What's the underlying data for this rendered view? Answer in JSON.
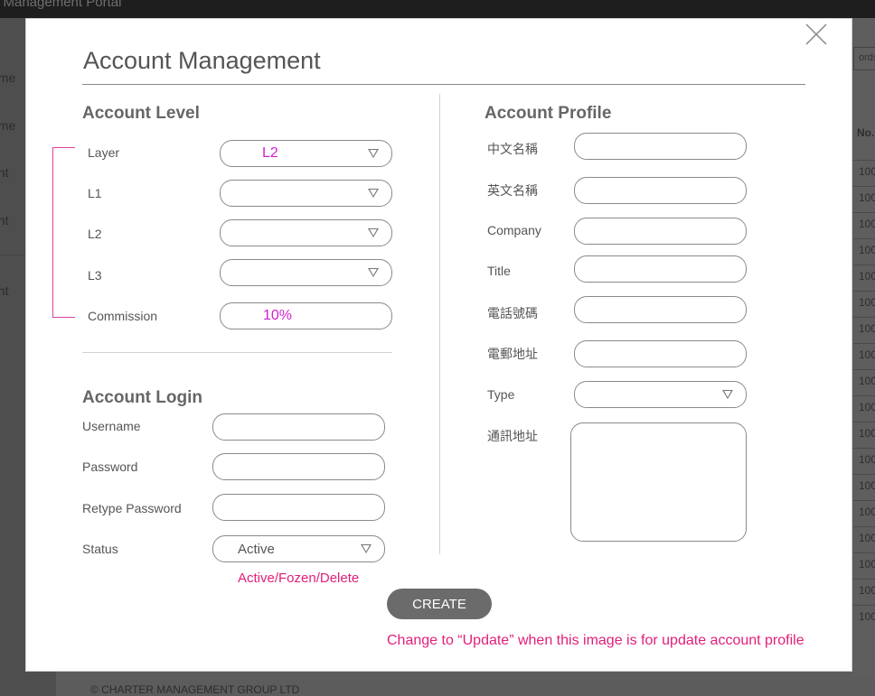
{
  "background": {
    "app_title": "er Management Portal",
    "sidebar_items": [
      "eme",
      "eme",
      "ent",
      "ent",
      "ent"
    ],
    "search_hint": "ords",
    "table_header": "No.",
    "table_cells": [
      "100",
      "100",
      "100",
      "100",
      "100",
      "100",
      "100",
      "100",
      "100",
      "100",
      "100",
      "100",
      "100",
      "100",
      "100",
      "100",
      "100",
      "100"
    ],
    "footer": "© CHARTER MANAGEMENT GROUP LTD"
  },
  "modal": {
    "title": "Account Management",
    "close_icon": "close-icon"
  },
  "account_level": {
    "heading": "Account Level",
    "layer_label": "Layer",
    "layer_value": "L2",
    "l1_label": "L1",
    "l2_label": "L2",
    "l3_label": "L3",
    "commission_label": "Commission",
    "commission_value": "10%",
    "highlight_color": "#d11fd1"
  },
  "account_login": {
    "heading": "Account Login",
    "username_label": "Username",
    "password_label": "Password",
    "retype_label": "Retype Password",
    "status_label": "Status",
    "status_value": "Active",
    "status_note": "Active/Fozen/Delete"
  },
  "account_profile": {
    "heading": "Account Profile",
    "chinese_name_label": "中文名稱",
    "english_name_label": "英文名稱",
    "company_label": "Company",
    "title_label": "Title",
    "phone_label": "電話號碼",
    "email_label": "電郵地址",
    "type_label": "Type",
    "address_label": "通訊地址"
  },
  "actions": {
    "create_label": "CREATE",
    "update_note": "Change to “Update” when this image is for update account profile"
  }
}
